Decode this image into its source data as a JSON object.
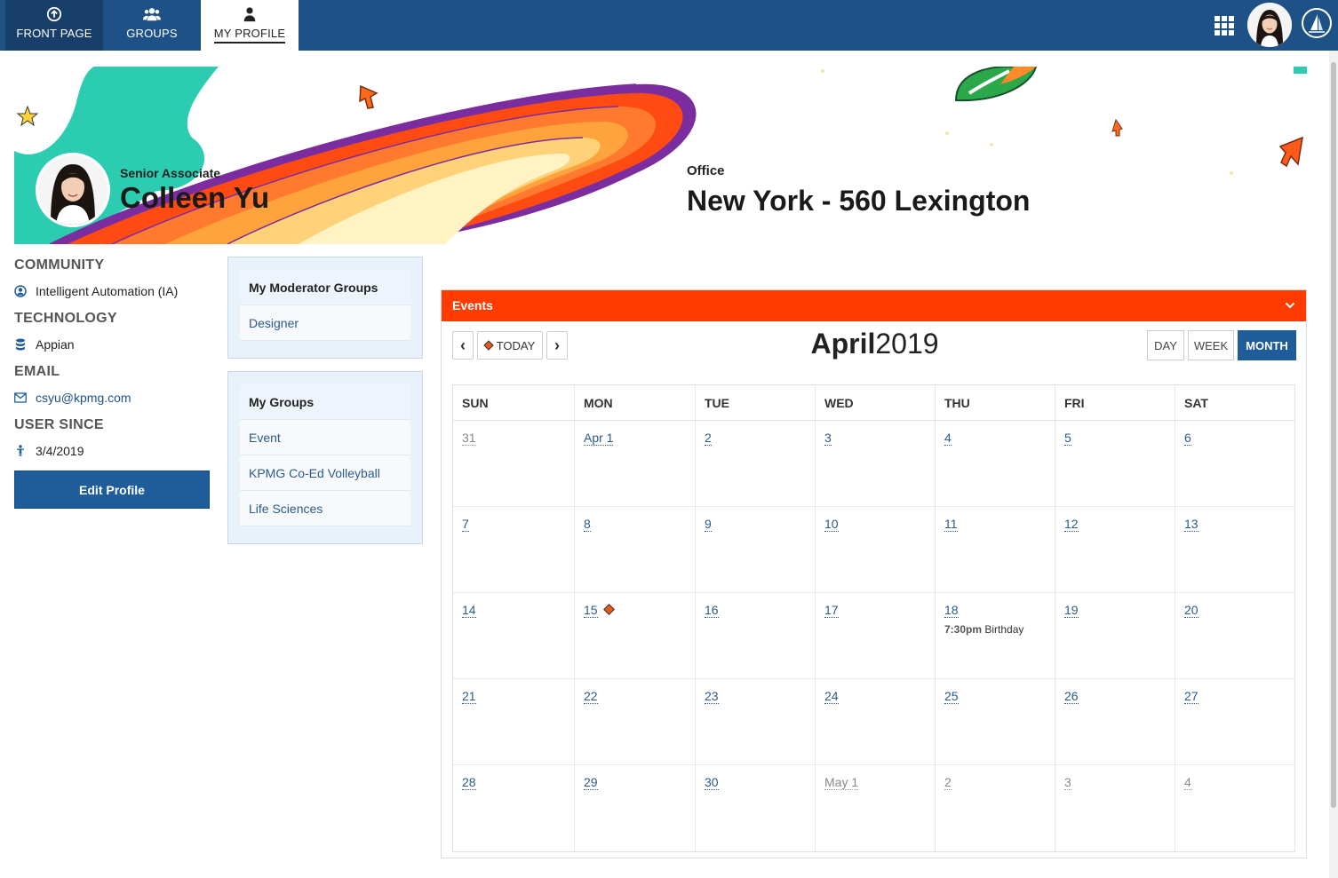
{
  "nav": {
    "tabs": [
      {
        "label": "FRONT PAGE",
        "icon": "arrow-up-circle-icon"
      },
      {
        "label": "GROUPS",
        "icon": "users-icon"
      },
      {
        "label": "MY PROFILE",
        "icon": "user-icon"
      }
    ]
  },
  "profile": {
    "job_title": "Senior Associate",
    "name": "Colleen Yu",
    "office_label": "Office",
    "office": "New York - 560 Lexington"
  },
  "info": {
    "community_label": "COMMUNITY",
    "community": "Intelligent Automation (IA)",
    "technology_label": "TECHNOLOGY",
    "technology": "Appian",
    "email_label": "EMAIL",
    "email": "csyu@kpmg.com",
    "user_since_label": "USER SINCE",
    "user_since": "3/4/2019",
    "edit_button": "Edit Profile"
  },
  "moderator_groups": {
    "title": "My Moderator Groups",
    "items": [
      "Designer"
    ]
  },
  "my_groups": {
    "title": "My Groups",
    "items": [
      "Event",
      "KPMG Co-Ed Volleyball",
      "Life Sciences"
    ]
  },
  "events": {
    "title": "Events",
    "today_label": "TODAY",
    "prev": "‹",
    "next": "›",
    "month": "April",
    "year": "2019",
    "views": [
      "DAY",
      "WEEK",
      "MONTH"
    ],
    "active_view": "MONTH",
    "weekdays": [
      "SUN",
      "MON",
      "TUE",
      "WED",
      "THU",
      "FRI",
      "SAT"
    ],
    "weeks": [
      [
        {
          "d": "31",
          "other": true
        },
        {
          "d": "Apr 1"
        },
        {
          "d": "2"
        },
        {
          "d": "3"
        },
        {
          "d": "4"
        },
        {
          "d": "5"
        },
        {
          "d": "6"
        }
      ],
      [
        {
          "d": "7"
        },
        {
          "d": "8"
        },
        {
          "d": "9"
        },
        {
          "d": "10"
        },
        {
          "d": "11"
        },
        {
          "d": "12"
        },
        {
          "d": "13"
        }
      ],
      [
        {
          "d": "14"
        },
        {
          "d": "15",
          "today": true
        },
        {
          "d": "16"
        },
        {
          "d": "17"
        },
        {
          "d": "18",
          "event_time": "7:30pm",
          "event_title": "Birthday"
        },
        {
          "d": "19"
        },
        {
          "d": "20"
        }
      ],
      [
        {
          "d": "21"
        },
        {
          "d": "22"
        },
        {
          "d": "23"
        },
        {
          "d": "24"
        },
        {
          "d": "25"
        },
        {
          "d": "26"
        },
        {
          "d": "27"
        }
      ],
      [
        {
          "d": "28"
        },
        {
          "d": "29"
        },
        {
          "d": "30"
        },
        {
          "d": "May 1",
          "other": true
        },
        {
          "d": "2",
          "other": true
        },
        {
          "d": "3",
          "other": true
        },
        {
          "d": "4",
          "other": true
        }
      ]
    ]
  },
  "colors": {
    "nav_bg": "#1e5186",
    "events_header": "#ff3b00",
    "accent_blue": "#1e5c9a",
    "today_marker": "#e85a1a"
  }
}
